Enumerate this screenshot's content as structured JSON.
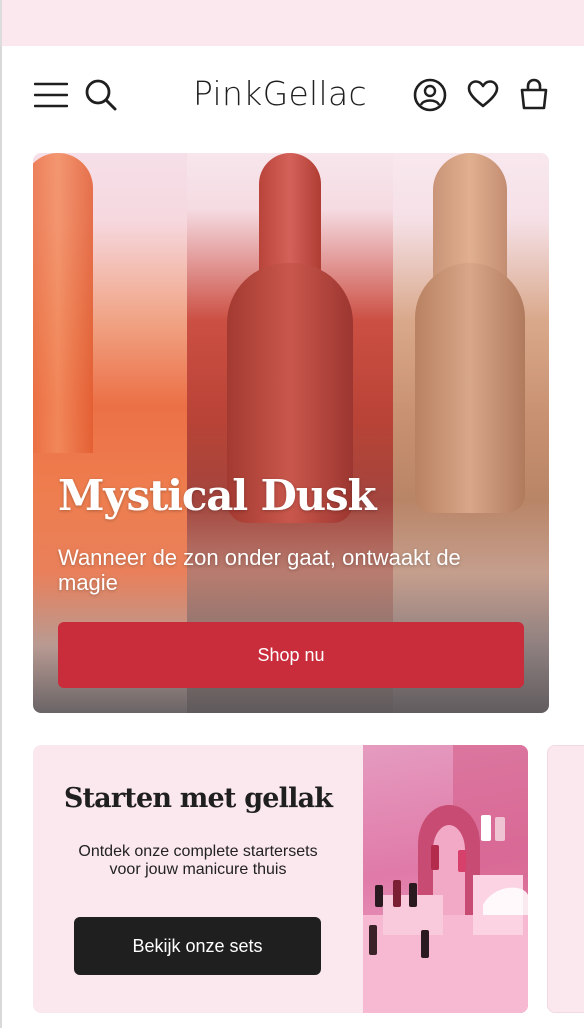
{
  "header": {
    "logo": "PinkGellac",
    "icons": [
      "menu-icon",
      "search-icon",
      "account-icon",
      "heart-icon",
      "bag-icon"
    ]
  },
  "hero": {
    "title": "Mystical Dusk",
    "subtitle": "Wanneer de zon onder gaat, ontwaakt de magie",
    "button_label": "Shop nu",
    "button_color": "#c92c3b"
  },
  "promo_card": {
    "title": "Starten met gellak",
    "text": "Ontdek onze complete startersets voor jouw manicure thuis",
    "button_label": "Bekijk onze sets",
    "background": "#fbe8ef"
  }
}
